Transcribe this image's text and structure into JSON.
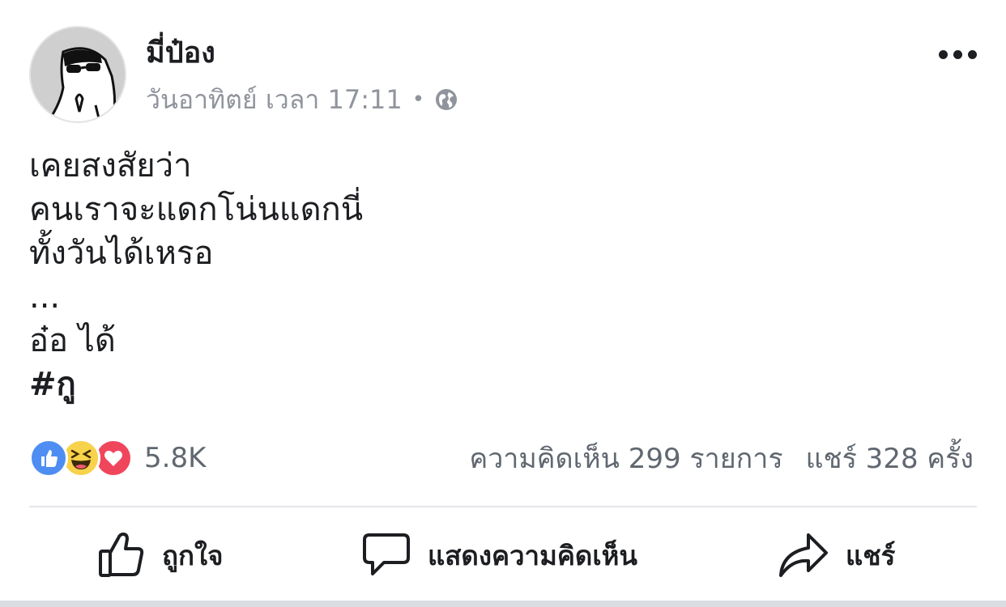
{
  "post": {
    "author": "มี่ป๋อง",
    "timestamp": "วันอาทิตย์ เวลา 17:11",
    "separator": "•",
    "privacy_icon": "globe-icon",
    "more_icon": "more-options-icon",
    "lines": [
      "เคยสงสัยว่า",
      "คนเราจะแดกโน่นแดกนี่",
      "ทั้งวันได้เหรอ",
      "...",
      "อ๋อ ได้"
    ],
    "hashtag": "#กู"
  },
  "stats": {
    "reaction_icons": [
      "like-reaction-icon",
      "haha-reaction-icon",
      "love-reaction-icon"
    ],
    "reaction_count": "5.8K",
    "comments": "ความคิดเห็น 299 รายการ",
    "shares": "แชร์ 328 ครั้ง"
  },
  "actions": {
    "like_label": "ถูกใจ",
    "comment_label": "แสดงความคิดเห็น",
    "share_label": "แชร์"
  },
  "colors": {
    "like_blue": "#4e8ef3",
    "haha_yellow": "#f7d24a",
    "love_red": "#f0465c",
    "meta_gray": "#90949c",
    "text": "#1c1e21"
  }
}
